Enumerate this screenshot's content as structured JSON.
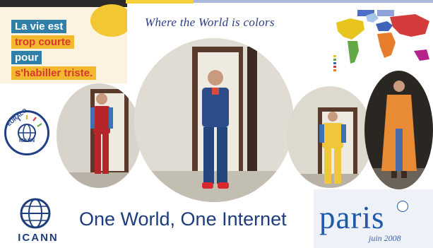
{
  "poster": {
    "line1": "La vie est",
    "line2": "trop courte",
    "line3": "pour",
    "line4": "s'habiller triste."
  },
  "tagline": "Where the World is colors",
  "badge": {
    "top_text": "EURALO",
    "bottom_text": "ICANN"
  },
  "logo": {
    "wordmark": "ICANN"
  },
  "slogan": "One World, One Internet",
  "event": {
    "city": "paris",
    "date": "juin 2008"
  },
  "colors": {
    "brand_blue": "#1c3c7d",
    "paris_blue": "#1e5aa8",
    "poster_blue": "#2f7fa8",
    "poster_yellow": "#f2b82e",
    "poster_red": "#d6392f"
  }
}
